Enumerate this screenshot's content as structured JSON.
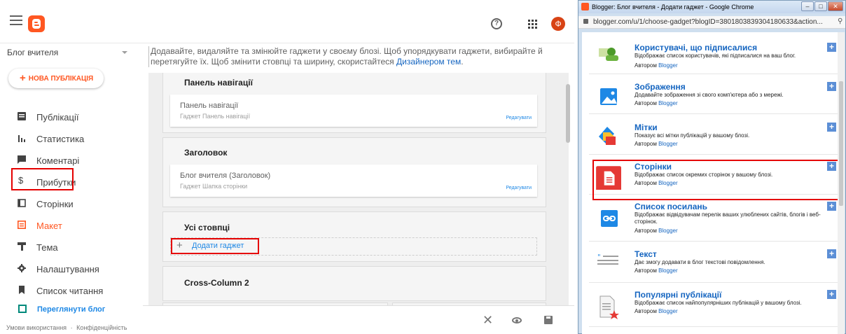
{
  "blogger": {
    "avatar_letter": "Ф",
    "help_glyph": "?",
    "blog_name": "Блог вчителя",
    "new_post": "НОВА ПУБЛІКАЦІЯ",
    "nav": [
      {
        "label": "Публікації",
        "icon": "posts-icon"
      },
      {
        "label": "Статистика",
        "icon": "stats-icon"
      },
      {
        "label": "Коментарі",
        "icon": "comments-icon"
      },
      {
        "label": "Прибутки",
        "icon": "dollar-icon"
      },
      {
        "label": "Сторінки",
        "icon": "pages-icon"
      },
      {
        "label": "Макет",
        "icon": "layout-icon",
        "active": true
      },
      {
        "label": "Тема",
        "icon": "theme-icon"
      },
      {
        "label": "Налаштування",
        "icon": "gear-icon"
      },
      {
        "label": "Список читання",
        "icon": "bookmark-icon"
      }
    ],
    "view_blog": "Переглянути блог",
    "footer_terms": "Умови використання",
    "footer_sep": "·",
    "footer_privacy": "Конфіденційність",
    "info_text": "Додавайте, видаляйте та змінюйте гаджети у своєму блозі. Щоб упорядкувати гаджети, вибирайте й перетягуйте їх. Щоб змінити стовпці та ширину, скористайтеся ",
    "info_link": "Дизайнером тем",
    "info_end": ".",
    "sections": {
      "nav_panel_title": "Панель навігації",
      "nav_panel_gadget": "Панель навігації",
      "nav_panel_sub": "Гаджет Панель навігації",
      "header_title": "Заголовок",
      "header_gadget": "Блог вчителя (Заголовок)",
      "header_sub": "Гаджет Шапка сторінки",
      "edit_label": "Редагувати",
      "all_columns_title": "Усі стовпці",
      "add_gadget": "Додати гаджет",
      "add_plus": "+",
      "cross_column_title": "Cross-Column 2"
    },
    "close_glyph": "✕"
  },
  "popup": {
    "title": "Blogger: Блог вчителя - Додати гаджет - Google Chrome",
    "url": "blogger.com/u/1/choose-gadget?blogID=3801803839304180633&action...",
    "win_min": "–",
    "win_max": "□",
    "win_close": "✕",
    "add_glyph": "+",
    "author_prefix": "Автором ",
    "author": "Blogger",
    "gadgets": [
      {
        "title": "Користувачі, що підписалися",
        "desc": "Відображає список користувачів, які підписалися на ваш блог.",
        "icon": "followers-icon"
      },
      {
        "title": "Зображення",
        "desc": "Додавайте зображення зі свого комп'ютера або з мережі.",
        "icon": "image-icon"
      },
      {
        "title": "Мітки",
        "desc": "Показує всі мітки публікацій у вашому блозі.",
        "icon": "labels-icon"
      },
      {
        "title": "Сторінки",
        "desc": "Відображає список окремих сторінок у вашому блозі.",
        "icon": "pages-gadget-icon"
      },
      {
        "title": "Список посилань",
        "desc": "Відображає відвідувачам перелік ваших улюблених сайтів, блогів і веб-сторінок.",
        "icon": "link-icon"
      },
      {
        "title": "Текст",
        "desc": "Дає змогу додавати в блог текстові повідомлення.",
        "icon": "text-icon"
      },
      {
        "title": "Популярні публікації",
        "desc": "Відображає список найпопулярніших публікацій у вашому блозі.",
        "icon": "popular-posts-icon"
      }
    ]
  }
}
